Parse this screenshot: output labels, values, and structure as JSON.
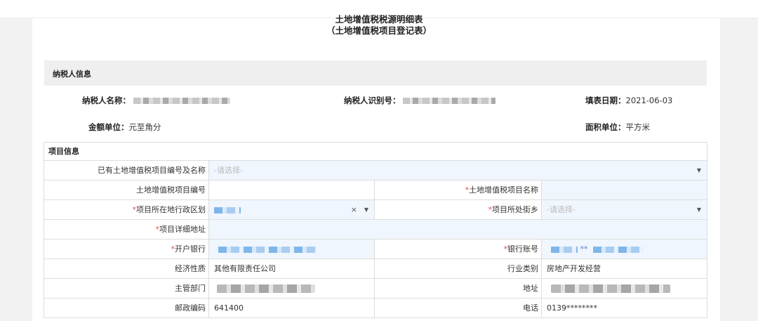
{
  "header": {
    "title": "土地增值税税源明细表",
    "subtitle": "（土地增值税项目登记表）"
  },
  "taxpayer_section": {
    "label": "纳税人信息",
    "name_label": "纳税人名称：",
    "id_label": "纳税人识别号：",
    "date_label": "填表日期：",
    "date_value": "2021-06-03",
    "amount_unit_label": "金额单位：",
    "amount_unit_value": "元至角分",
    "area_unit_label": "面积单位：",
    "area_unit_value": "平方米"
  },
  "project_section": {
    "label": "项目信息",
    "existing_project_label": "已有土地增值税项目编号及名称",
    "existing_project_placeholder": "-请选择-",
    "project_no_label": "土地增值税项目编号",
    "project_name_label": "土地增值税项目名称",
    "district_label": "项目所在地行政区划",
    "street_label": "项目所处街乡",
    "street_placeholder": "-请选择-",
    "address_label": "项目详细地址",
    "bank_label": "开户银行",
    "account_label": "银行账号",
    "account_visible": "**",
    "economic_nature_label": "经济性质",
    "economic_nature_value": "其他有限责任公司",
    "industry_label": "行业类别",
    "industry_value": "房地产开发经营",
    "authority_label": "主管部门",
    "addr_label": "地址",
    "postcode_label": "邮政编码",
    "postcode_value": "641400",
    "phone_label": "电话",
    "phone_value": "0139********",
    "required_mark": "*",
    "clear_glyph": "×",
    "caret_glyph": "▼"
  }
}
